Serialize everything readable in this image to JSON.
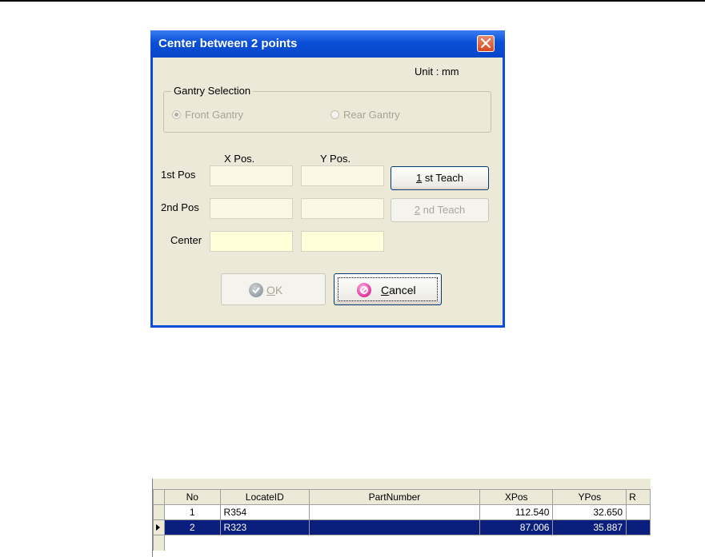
{
  "dialog": {
    "title": "Center between 2 points",
    "unit_label": "Unit : mm",
    "gantry": {
      "legend": "Gantry Selection",
      "front_label": "Front Gantry",
      "rear_label": "Rear Gantry",
      "selected": "front"
    },
    "columns": {
      "x": "X Pos.",
      "y": "Y Pos."
    },
    "rows": {
      "first": "1st Pos",
      "second": "2nd Pos",
      "center": "Center"
    },
    "teach1": {
      "key": "1",
      "rest": " st Teach"
    },
    "teach2": {
      "key": "2",
      "rest": " nd Teach"
    },
    "ok": {
      "key": "O",
      "rest": "K"
    },
    "cancel": {
      "key": "C",
      "rest": "ancel"
    },
    "colors": {
      "title_bar": "#0a4fd8",
      "client": "#ece9d8",
      "close": "#d9461d"
    }
  },
  "grid": {
    "headers": [
      "No",
      "LocateID",
      "PartNumber",
      "XPos",
      "YPos",
      "R"
    ],
    "rows": [
      {
        "no": "1",
        "locate_id": "R354",
        "part_number": "",
        "xpos": "112.540",
        "ypos": "32.650"
      },
      {
        "no": "2",
        "locate_id": "R323",
        "part_number": "",
        "xpos": "87.006",
        "ypos": "35.887"
      }
    ],
    "selected_row": 2,
    "colors": {
      "selection": "#0a1e7d"
    }
  }
}
